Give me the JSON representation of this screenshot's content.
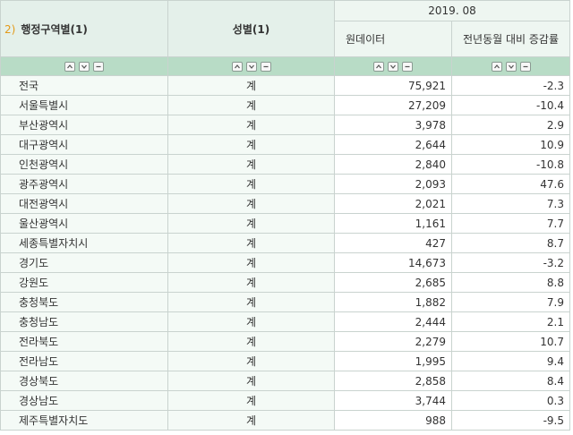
{
  "header": {
    "dim1_index": "2)",
    "dim1_label": "행정구역별(1)",
    "dim2_label": "성별(1)",
    "period": "2019. 08",
    "col_raw": "원데이터",
    "col_change": "전년동월 대비 증감률"
  },
  "controls": [
    "expand-up-icon",
    "expand-down-icon",
    "collapse-icon"
  ],
  "rows": [
    {
      "region": "전국",
      "sex": "계",
      "value": "75,921",
      "change": "-2.3"
    },
    {
      "region": "서울특별시",
      "sex": "계",
      "value": "27,209",
      "change": "-10.4"
    },
    {
      "region": "부산광역시",
      "sex": "계",
      "value": "3,978",
      "change": "2.9"
    },
    {
      "region": "대구광역시",
      "sex": "계",
      "value": "2,644",
      "change": "10.9"
    },
    {
      "region": "인천광역시",
      "sex": "계",
      "value": "2,840",
      "change": "-10.8"
    },
    {
      "region": "광주광역시",
      "sex": "계",
      "value": "2,093",
      "change": "47.6"
    },
    {
      "region": "대전광역시",
      "sex": "계",
      "value": "2,021",
      "change": "7.3"
    },
    {
      "region": "울산광역시",
      "sex": "계",
      "value": "1,161",
      "change": "7.7"
    },
    {
      "region": "세종특별자치시",
      "sex": "계",
      "value": "427",
      "change": "8.7"
    },
    {
      "region": "경기도",
      "sex": "계",
      "value": "14,673",
      "change": "-3.2"
    },
    {
      "region": "강원도",
      "sex": "계",
      "value": "2,685",
      "change": "8.8"
    },
    {
      "region": "충청북도",
      "sex": "계",
      "value": "1,882",
      "change": "7.9"
    },
    {
      "region": "충청남도",
      "sex": "계",
      "value": "2,444",
      "change": "2.1"
    },
    {
      "region": "전라북도",
      "sex": "계",
      "value": "2,279",
      "change": "10.7"
    },
    {
      "region": "전라남도",
      "sex": "계",
      "value": "1,995",
      "change": "9.4"
    },
    {
      "region": "경상북도",
      "sex": "계",
      "value": "2,858",
      "change": "8.4"
    },
    {
      "region": "경상남도",
      "sex": "계",
      "value": "3,744",
      "change": "0.3"
    },
    {
      "region": "제주특별자치도",
      "sex": "계",
      "value": "988",
      "change": "-9.5"
    }
  ]
}
